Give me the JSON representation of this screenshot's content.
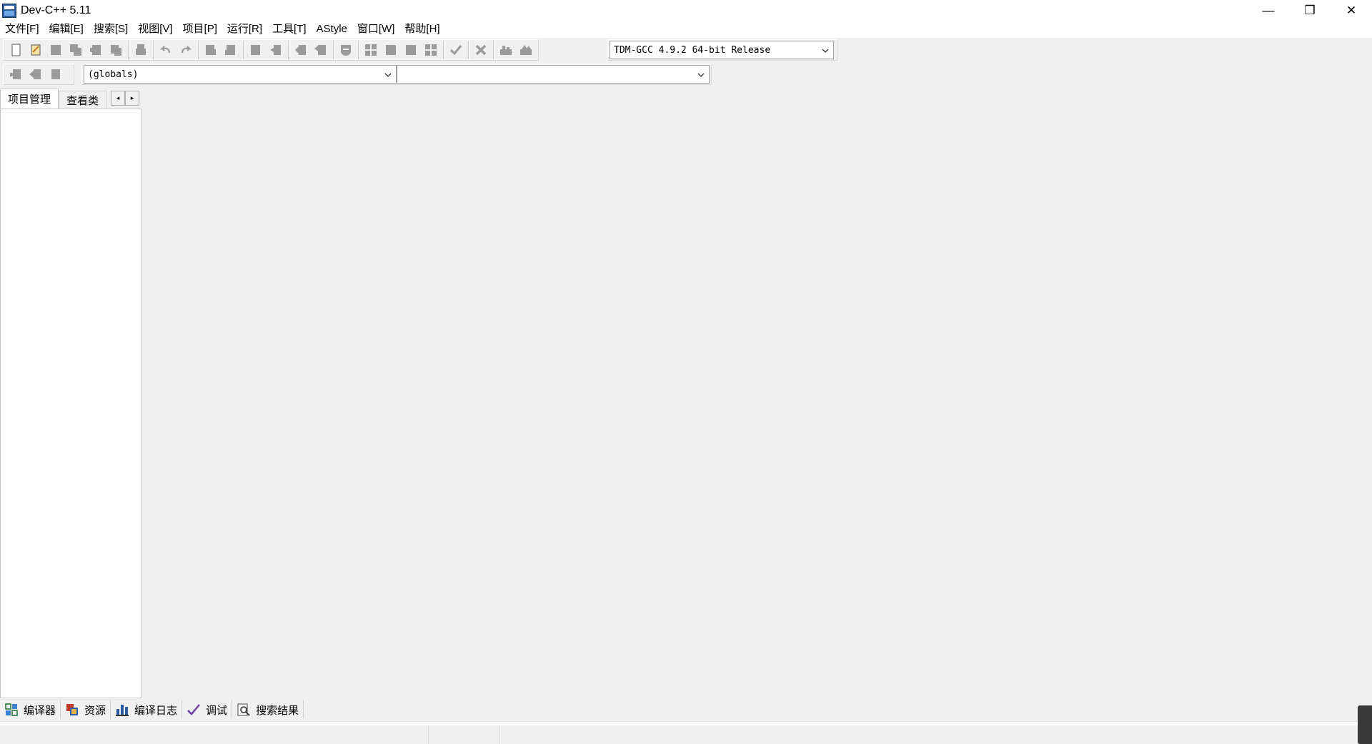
{
  "window": {
    "title": "Dev-C++ 5.11"
  },
  "window_controls": {
    "minimize": "—",
    "restore": "❐",
    "close": "✕"
  },
  "menu": [
    "文件[F]",
    "编辑[E]",
    "搜索[S]",
    "视图[V]",
    "项目[P]",
    "运行[R]",
    "工具[T]",
    "AStyle",
    "窗口[W]",
    "帮助[H]"
  ],
  "compiler_select": {
    "value": "TDM-GCC 4.9.2 64-bit Release"
  },
  "class_select": {
    "value": "(globals)"
  },
  "member_select": {
    "value": ""
  },
  "left_tabs": [
    "项目管理",
    "查看类"
  ],
  "tab_scroll": {
    "left": "◂",
    "right": "▸"
  },
  "bottom_tabs": [
    {
      "label": "编译器",
      "icon": "compiler-grid-icon"
    },
    {
      "label": "资源",
      "icon": "resources-icon"
    },
    {
      "label": "编译日志",
      "icon": "bar-chart-icon"
    },
    {
      "label": "调试",
      "icon": "checkmark-icon"
    },
    {
      "label": "搜索结果",
      "icon": "magnifier-icon"
    }
  ],
  "status": {
    "panel1": "",
    "panel2": "",
    "panel3": ""
  },
  "colors": {
    "toolbar_icon": "#8a8a8a",
    "window_bg": "#f0f0f0",
    "panel_bg": "#ffffff"
  }
}
